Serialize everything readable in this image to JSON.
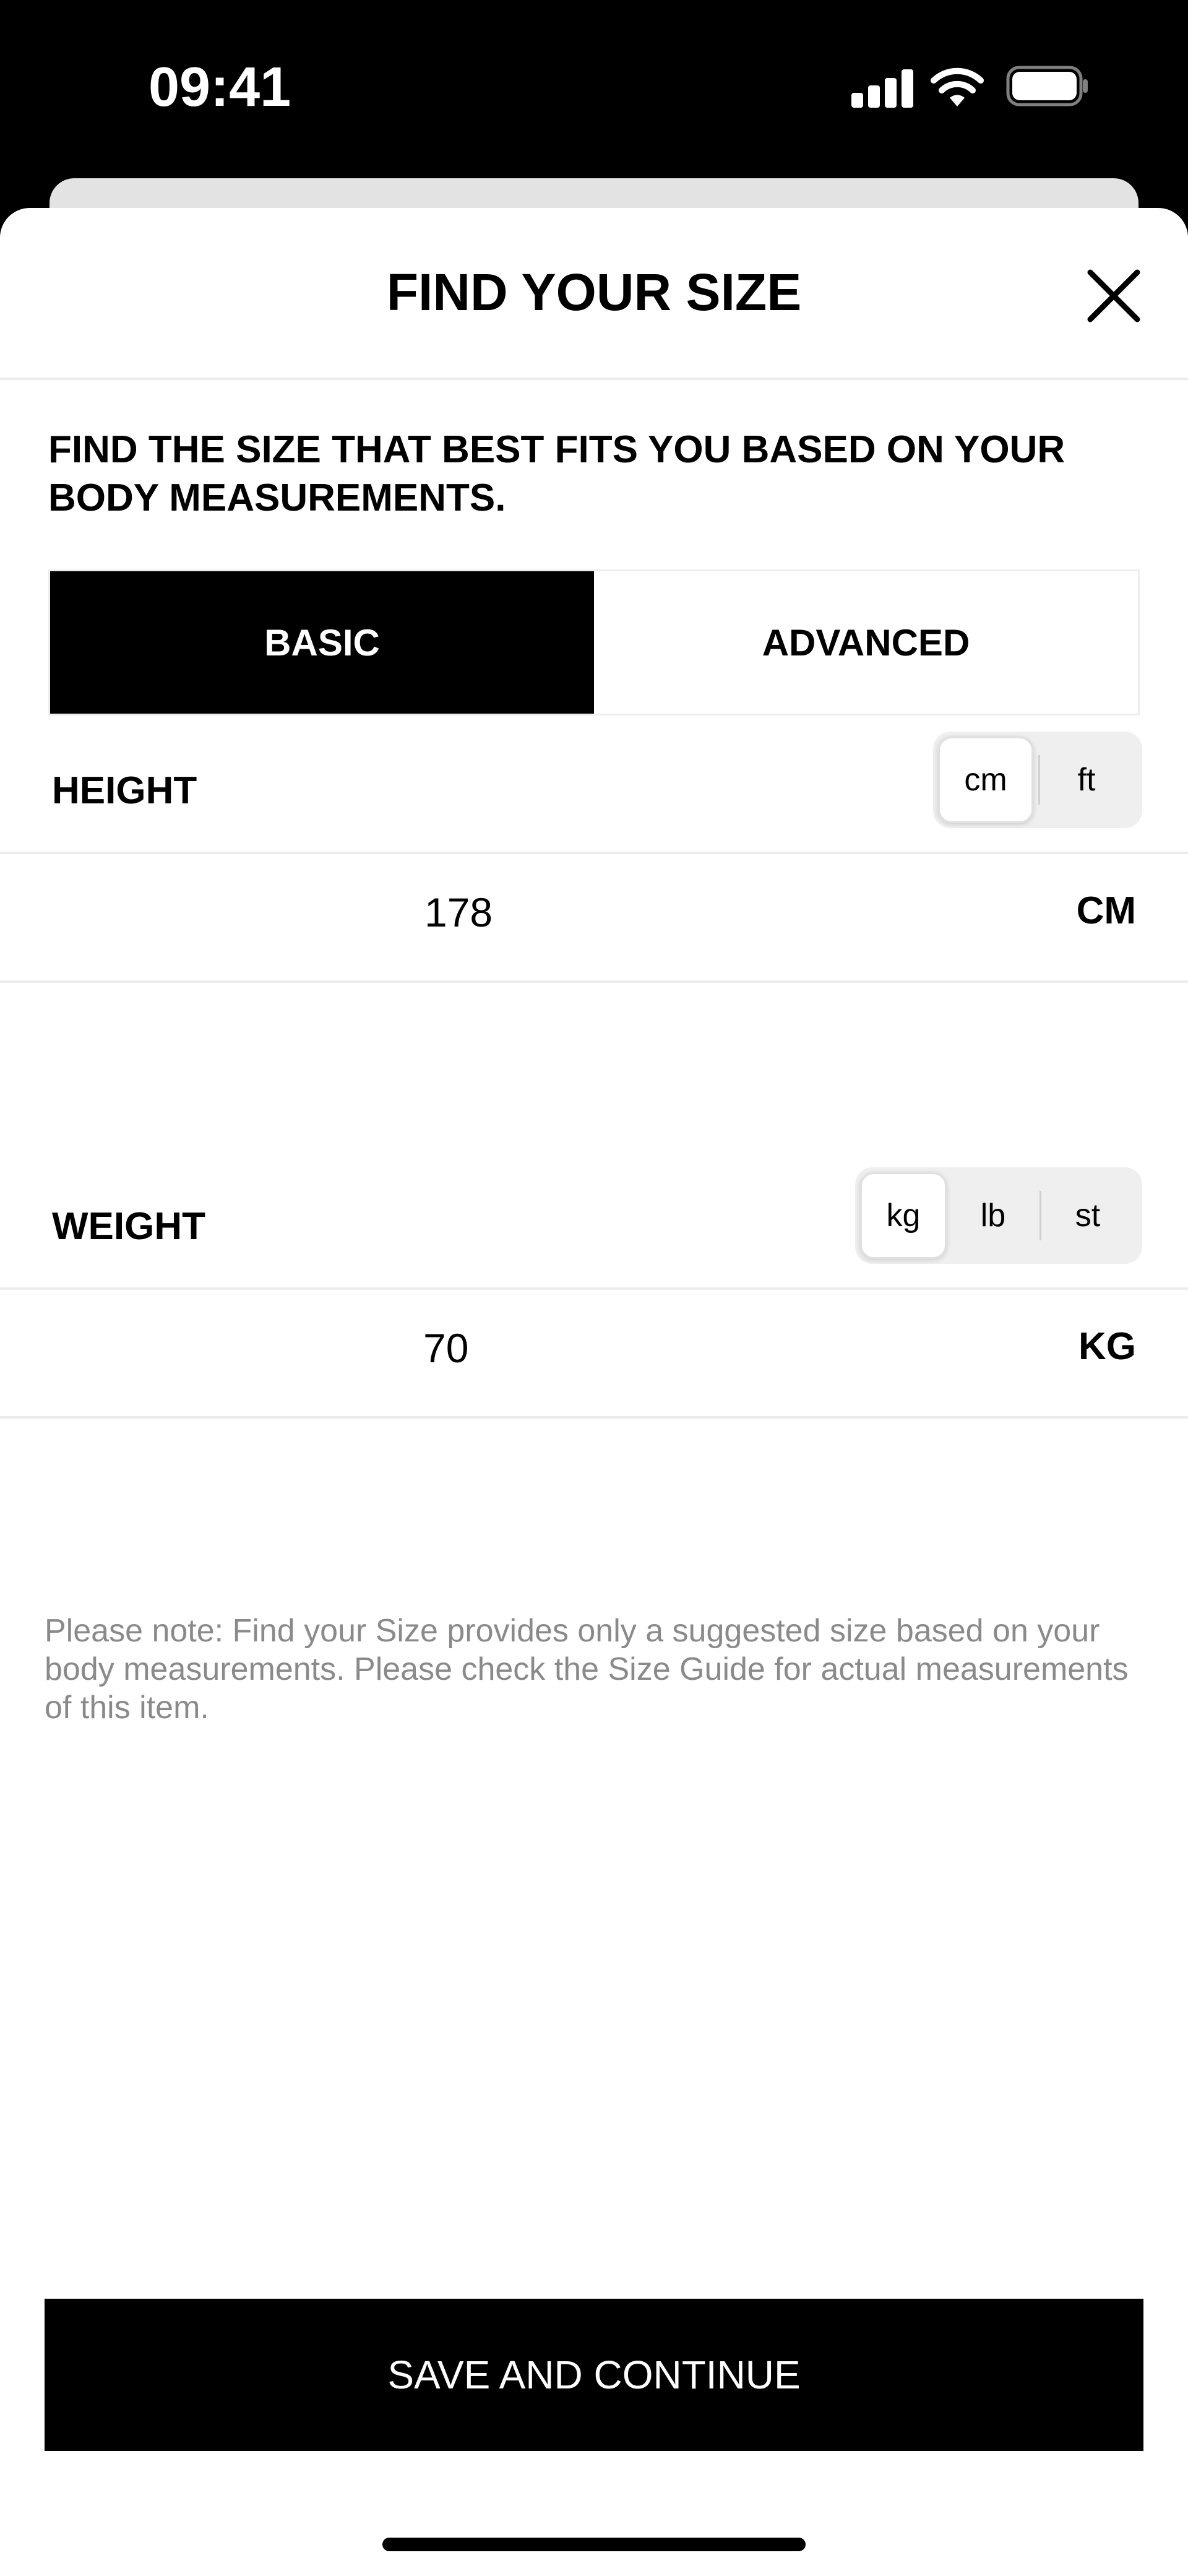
{
  "status_bar": {
    "time": "09:41",
    "icons": [
      "cellular-signal-icon",
      "wifi-icon",
      "battery-icon"
    ]
  },
  "header": {
    "title": "FIND YOUR SIZE",
    "close_icon": "close-icon"
  },
  "intro": "FIND THE SIZE THAT BEST FITS YOU BASED ON YOUR BODY MEASUREMENTS.",
  "tabs": [
    {
      "label": "BASIC",
      "selected": true
    },
    {
      "label": "ADVANCED",
      "selected": false
    }
  ],
  "height": {
    "label": "HEIGHT",
    "units": [
      {
        "label": "cm",
        "selected": true
      },
      {
        "label": "ft",
        "selected": false
      }
    ],
    "value": "178",
    "unit_label": "CM"
  },
  "weight": {
    "label": "WEIGHT",
    "units": [
      {
        "label": "kg",
        "selected": true
      },
      {
        "label": "lb",
        "selected": false
      },
      {
        "label": "st",
        "selected": false
      }
    ],
    "value": "70",
    "unit_label": "KG"
  },
  "note": "Please note: Find your Size provides only a suggested size based on your body measurements. Please check the Size Guide for actual measurements of this item.",
  "save_button": "SAVE AND CONTINUE",
  "colors": {
    "primary": "#000000",
    "background": "#ffffff",
    "muted_text": "#8a8a8a",
    "segment_bg": "#efefef"
  }
}
